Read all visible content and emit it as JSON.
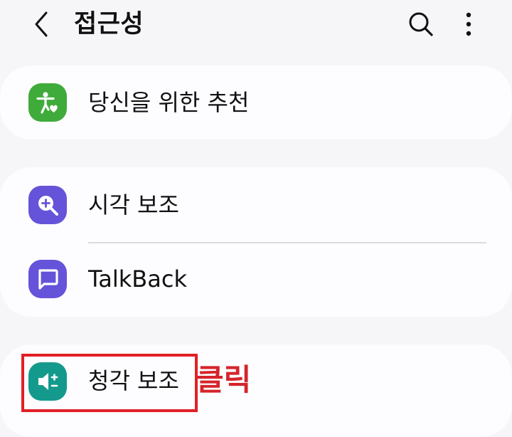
{
  "header": {
    "title": "접근성",
    "back_icon": "chevron-left-icon",
    "search_icon": "search-icon",
    "more_icon": "more-vertical-icon"
  },
  "groups": [
    {
      "items": [
        {
          "label": "당신을 위한 추천",
          "icon": "accessibility-heart-icon",
          "icon_bg": "#3fab3a"
        }
      ]
    },
    {
      "items": [
        {
          "label": "시각 보조",
          "icon": "magnifier-plus-icon",
          "icon_bg": "#6553d9"
        },
        {
          "label": "TalkBack",
          "icon": "speech-bubble-icon",
          "icon_bg": "#6553d9"
        }
      ]
    },
    {
      "items": [
        {
          "label": "청각 보조",
          "icon": "speaker-plus-minus-icon",
          "icon_bg": "#149a8d"
        }
      ]
    }
  ],
  "annotation": {
    "text": "클릭",
    "color": "#d5242b",
    "box_color": "#e21f26"
  }
}
